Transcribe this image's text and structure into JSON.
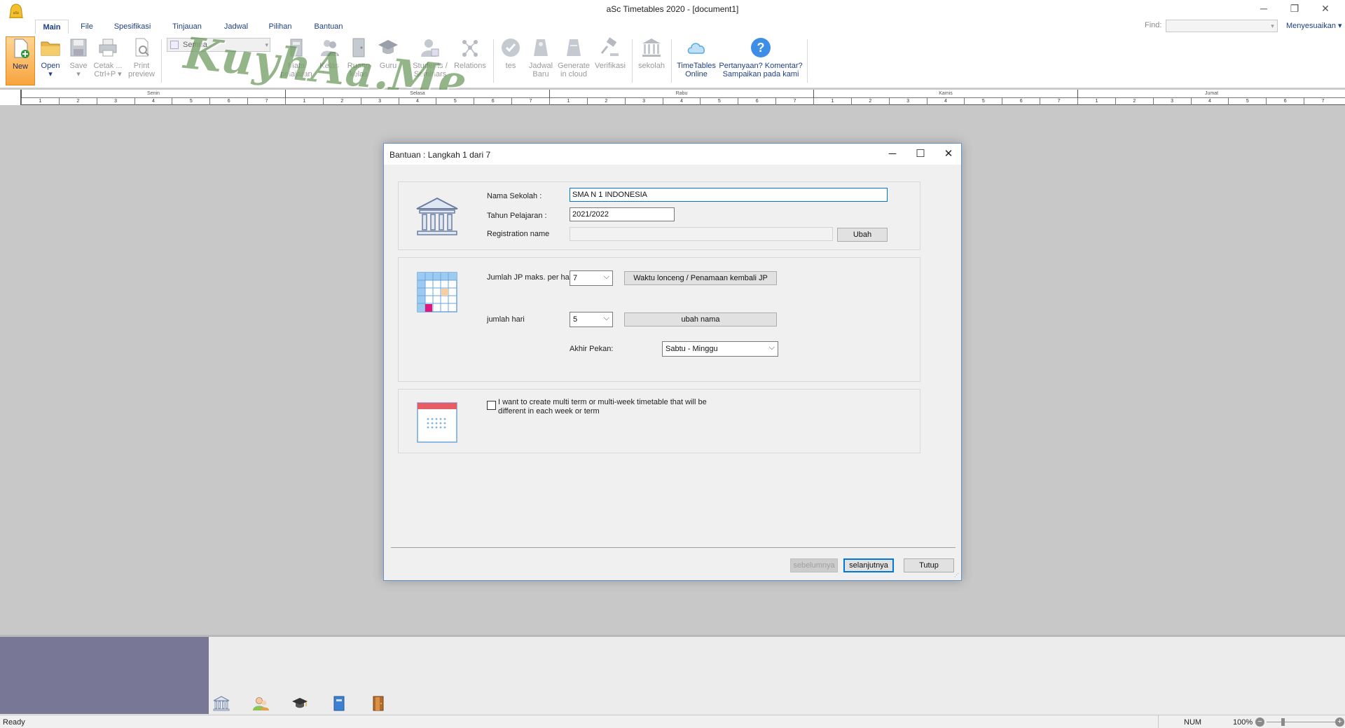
{
  "app": {
    "title": "aSc Timetables 2020  - [document1]",
    "minimize": "─",
    "restore": "❐",
    "close": "✕"
  },
  "tabs": [
    {
      "label": "Main"
    },
    {
      "label": "File"
    },
    {
      "label": "Spesifikasi"
    },
    {
      "label": "Tinjauan"
    },
    {
      "label": "Jadwal"
    },
    {
      "label": "Pilihan"
    },
    {
      "label": "Bantuan"
    }
  ],
  "find": {
    "label": "Find:",
    "value": ""
  },
  "customize": "Menyesuaikan ▾",
  "ribbon": {
    "new": "New",
    "open": "Open",
    "open_arrow": "▾",
    "save": "Save",
    "save_arrow": "▾",
    "print_l1": "Cetak ...",
    "print_l2": "Ctrl+P ▾",
    "preview_l1": "Print",
    "preview_l2": "preview",
    "filter": "Semua",
    "subjects_l1": "Mata",
    "subjects_l2": "pelajaran",
    "classes": "Kelas",
    "rooms_l1": "Ruang",
    "rooms_l2": "kelas",
    "teachers": "Guru",
    "students_l1": "Students /",
    "students_l2": "Seminars",
    "relations": "Relations",
    "tes": "tes",
    "new_schedule_l1": "Jadwal",
    "new_schedule_l2": "Baru",
    "cloud_l1": "Generate",
    "cloud_l2": "in cloud",
    "verify": "Verifikasi",
    "school": "sekolah",
    "online_l1": "TimeTables",
    "online_l2": "Online",
    "question_l1": "Pertanyaan? Komentar?",
    "question_l2": "Sampaikan pada kami"
  },
  "watermark": "KuyhAa.Me",
  "grid": {
    "days": [
      "Senin",
      "Selasa",
      "Rabu",
      "Kamis",
      "Jumat"
    ],
    "periods": [
      "1",
      "2",
      "3",
      "4",
      "5",
      "6",
      "7"
    ]
  },
  "dialog": {
    "title": "Bantuan : Langkah 1 dari 7",
    "min": "─",
    "max": "☐",
    "close": "✕",
    "school_name_label": "Nama Sekolah :",
    "school_name_value": "SMA N 1 INDONESIA",
    "year_label": "Tahun Pelajaran :",
    "year_value": "2021/2022",
    "reg_label": "Registration name",
    "reg_value": "",
    "change_btn": "Ubah",
    "periods_label": "Jumlah JP maks. per hari:",
    "periods_value": "7",
    "bell_btn": "Waktu lonceng / Penamaan kembali JP",
    "days_label": "jumlah hari",
    "days_value": "5",
    "rename_btn": "ubah nama",
    "weekend_label": "Akhir Pekan:",
    "weekend_value": "Sabtu - Minggu",
    "multiterm_l1": "I want to create multi term or multi-week timetable that will be",
    "multiterm_l2": "different in each week or term",
    "prev_btn": "sebelumnya",
    "next_btn": "selanjutnya",
    "close_btn": "Tutup"
  },
  "status": {
    "ready": "Ready",
    "num": "NUM",
    "zoom": "100%",
    "zoom_minus": "−",
    "zoom_plus": "+"
  },
  "colors": {
    "accent": "#1e3f86",
    "dialog_border": "#5f93cc",
    "focus": "#0078d7",
    "new_button": "#f7a43e",
    "bottom_panel": "#787896"
  }
}
